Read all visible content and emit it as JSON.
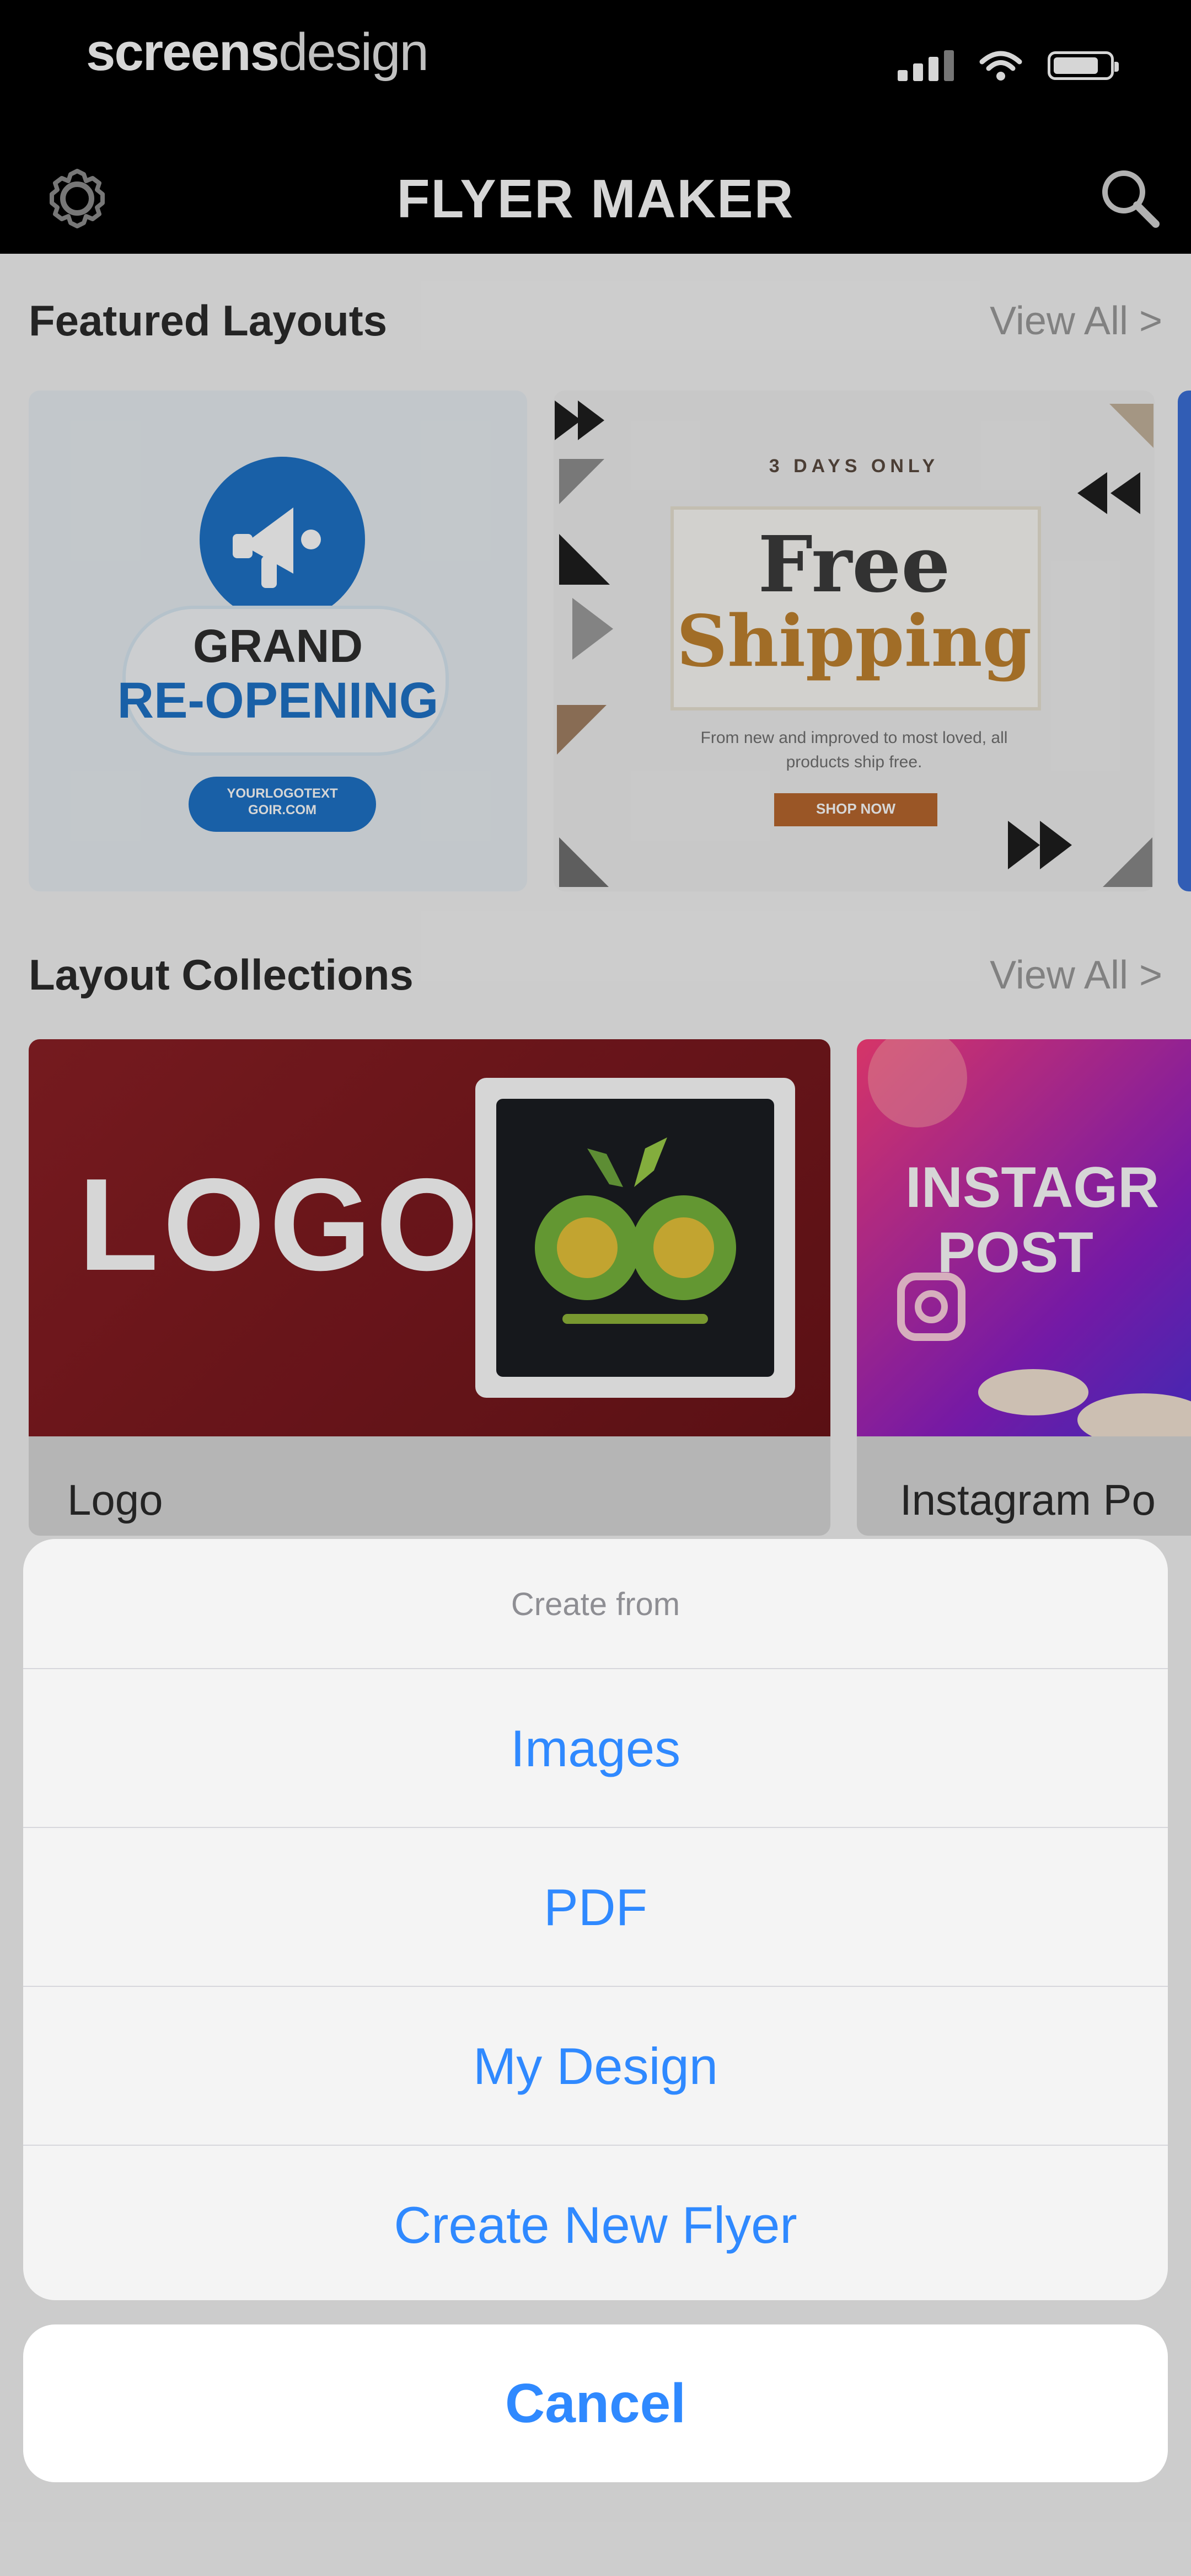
{
  "status_bar": {
    "brand_bold": "screens",
    "brand_light": "design"
  },
  "nav": {
    "title": "FLYER MAKER",
    "left_icon": "gear-icon",
    "right_icon": "search-icon"
  },
  "sections": {
    "featured": {
      "title": "Featured Layouts",
      "view_all": "View All >"
    },
    "collections": {
      "title": "Layout Collections",
      "view_all": "View All >"
    }
  },
  "featured_cards": [
    {
      "title": "GRAND",
      "subtitle": "RE-OPENING",
      "button": "YOURLOGOTEXT\nGOIR.COM"
    },
    {
      "eyebrow": "3 DAYS ONLY",
      "title": "Free",
      "subtitle": "Shipping",
      "body": "From new and improved to most loved, all products ship free.",
      "button": "SHOP NOW"
    }
  ],
  "collection_cards": [
    {
      "image_word": "LOGO",
      "label": "Logo"
    },
    {
      "image_text": "INSTAGR\n  POST",
      "label": "Instagram Po"
    }
  ],
  "action_sheet": {
    "title": "Create from",
    "options": [
      "Images",
      "PDF",
      "My Design",
      "Create New Flyer"
    ],
    "cancel": "Cancel"
  },
  "colors": {
    "accent_blue": "#2f89ff",
    "logo_red": "#8c1f25",
    "instagram_gradient": "#ff3f7c"
  }
}
